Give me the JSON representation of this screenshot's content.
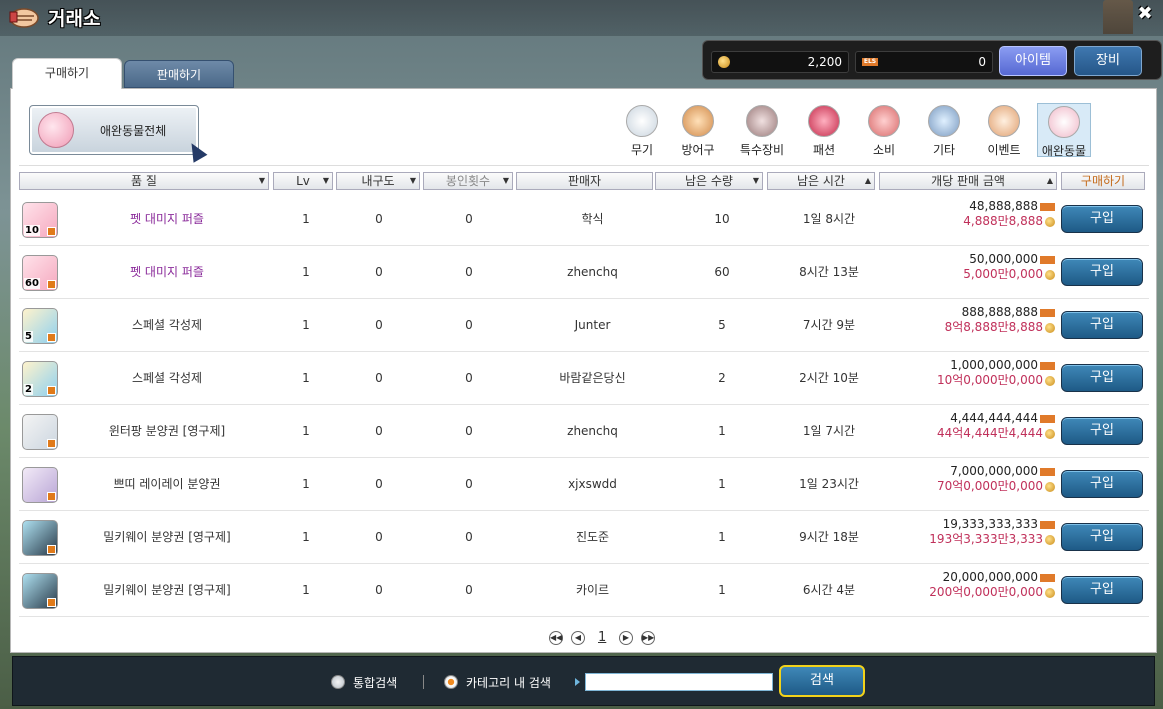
{
  "window": {
    "title": "거래소",
    "close": "✖"
  },
  "wallet": {
    "meso": "2,200",
    "els_label": "ELS",
    "els": "0",
    "item_button": "아이템",
    "equip_button": "장비"
  },
  "tabs": {
    "buy": "구매하기",
    "sell": "판매하기"
  },
  "pet_all_button": "애완동물전체",
  "categories": [
    {
      "label": "무기",
      "icon": "weapon-icon"
    },
    {
      "label": "방어구",
      "icon": "armor-icon"
    },
    {
      "label": "특수장비",
      "icon": "special-equipment-icon"
    },
    {
      "label": "패션",
      "icon": "fashion-icon"
    },
    {
      "label": "소비",
      "icon": "consumable-icon"
    },
    {
      "label": "기타",
      "icon": "etc-icon"
    },
    {
      "label": "이벤트",
      "icon": "event-tag-icon"
    },
    {
      "label": "애완동물",
      "icon": "pet-icon",
      "selected": true
    }
  ],
  "columns": {
    "grade": "품 질",
    "lv": "Lv",
    "durability": "내구도",
    "seal": "봉인횟수",
    "seller": "판매자",
    "remaining_qty": "남은 수량",
    "remaining_time": "남은 시간",
    "price": "개당 판매 금액",
    "buy": "구매하기"
  },
  "rows": [
    {
      "qty_badge": "10",
      "name": "펫 대미지 퍼즐",
      "lv": "1",
      "dur": "0",
      "seal": "0",
      "seller": "학식",
      "qty": "10",
      "time": "1일 8시간",
      "price": "48,888,888",
      "price_kr": "4,888만8,888",
      "buy": "구입"
    },
    {
      "qty_badge": "60",
      "name": "펫 대미지 퍼즐",
      "lv": "1",
      "dur": "0",
      "seal": "0",
      "seller": "zhenchq",
      "qty": "60",
      "time": "8시간 13분",
      "price": "50,000,000",
      "price_kr": "5,000만0,000",
      "buy": "구입"
    },
    {
      "qty_badge": "5",
      "name": "스페셜 각성제",
      "lv": "1",
      "dur": "0",
      "seal": "0",
      "seller": "Junter",
      "qty": "5",
      "time": "7시간 9분",
      "price": "888,888,888",
      "price_kr": "8억8,888만8,888",
      "buy": "구입"
    },
    {
      "qty_badge": "2",
      "name": "스페셜 각성제",
      "lv": "1",
      "dur": "0",
      "seal": "0",
      "seller": "바람같은당신",
      "qty": "2",
      "time": "2시간 10분",
      "price": "1,000,000,000",
      "price_kr": "10억0,000만0,000",
      "buy": "구입"
    },
    {
      "qty_badge": "",
      "name": "윈터팡 분양권 [영구제]",
      "lv": "1",
      "dur": "0",
      "seal": "0",
      "seller": "zhenchq",
      "qty": "1",
      "time": "1일 7시간",
      "price": "4,444,444,444",
      "price_kr": "44억4,444만4,444",
      "buy": "구입"
    },
    {
      "qty_badge": "",
      "name": "쁘띠 레이레이 분양권",
      "lv": "1",
      "dur": "0",
      "seal": "0",
      "seller": "xjxswdd",
      "qty": "1",
      "time": "1일 23시간",
      "price": "7,000,000,000",
      "price_kr": "70억0,000만0,000",
      "buy": "구입"
    },
    {
      "qty_badge": "",
      "name": "밀키웨이 분양권 [영구제]",
      "lv": "1",
      "dur": "0",
      "seal": "0",
      "seller": "진도준",
      "qty": "1",
      "time": "9시간 18분",
      "price": "19,333,333,333",
      "price_kr": "193억3,333만3,333",
      "buy": "구입"
    },
    {
      "qty_badge": "",
      "name": "밀키웨이 분양권 [영구제]",
      "lv": "1",
      "dur": "0",
      "seal": "0",
      "seller": "카이르",
      "qty": "1",
      "time": "6시간 4분",
      "price": "20,000,000,000",
      "price_kr": "200억0,000만0,000",
      "buy": "구입"
    }
  ],
  "pagination": {
    "current": "1"
  },
  "search": {
    "integrated": "통합검색",
    "in_category": "카테고리 내 검색",
    "value": "",
    "button": "검색"
  }
}
